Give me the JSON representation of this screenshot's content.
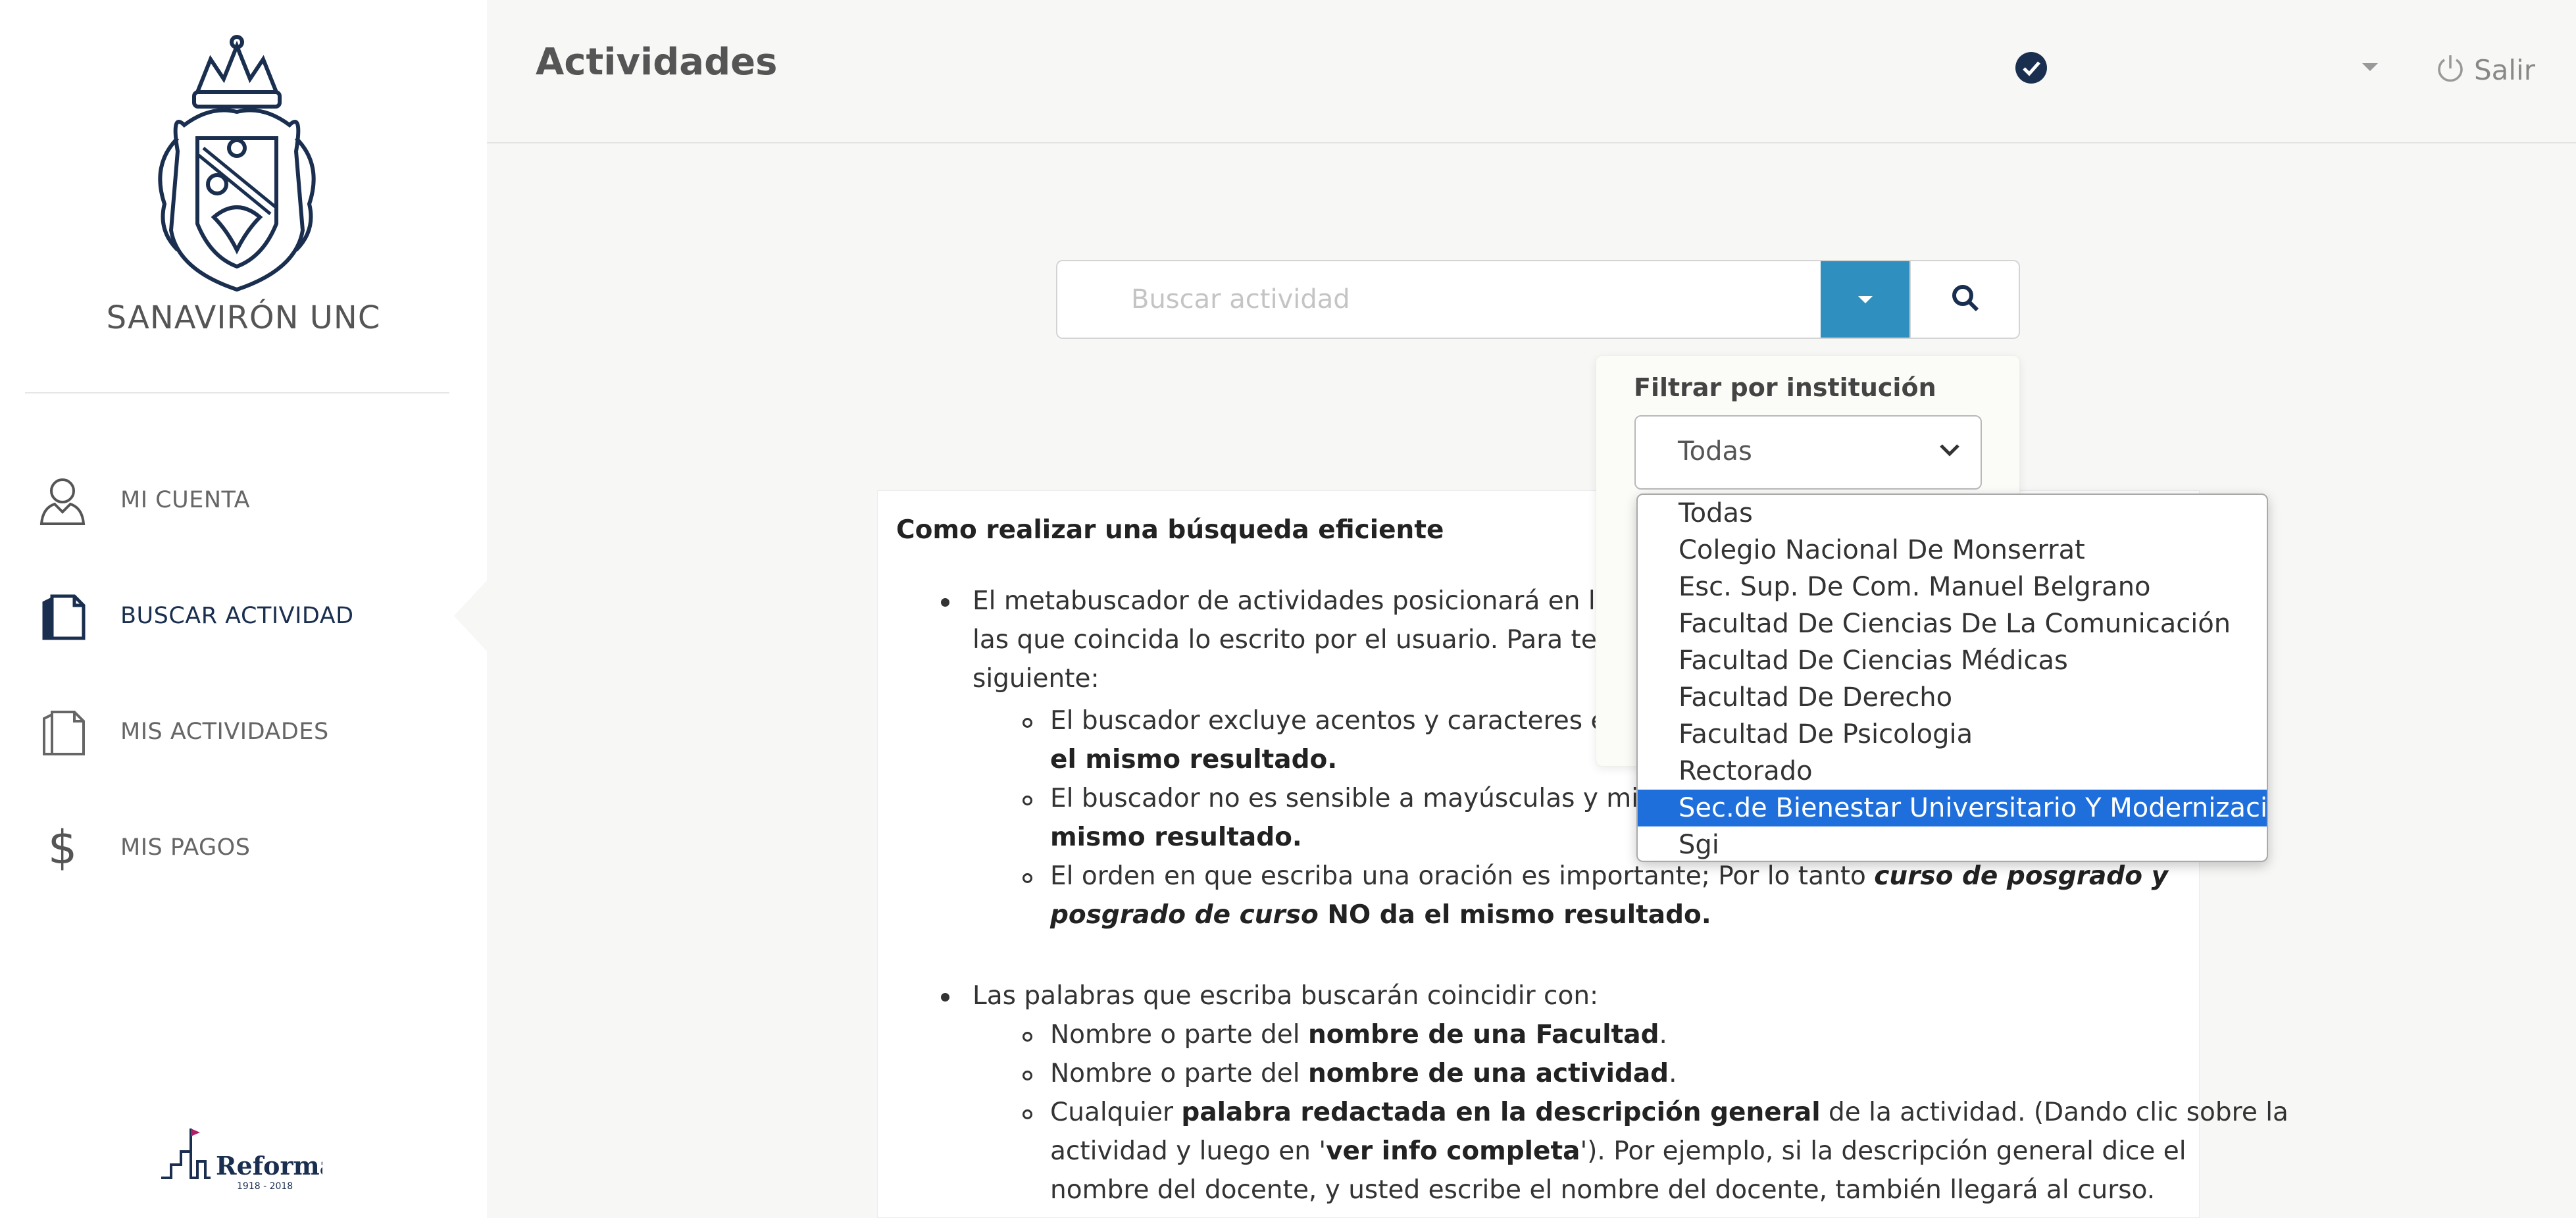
{
  "brand": {
    "name": "SANAVIRÓN UNC"
  },
  "sidebar": {
    "items": [
      {
        "label": "MI CUENTA",
        "icon": "user-icon",
        "active": false
      },
      {
        "label": "BUSCAR ACTIVIDAD",
        "icon": "documents-icon",
        "active": true
      },
      {
        "label": "MIS ACTIVIDADES",
        "icon": "documents-icon",
        "active": false
      },
      {
        "label": "MIS PAGOS",
        "icon": "dollar-icon",
        "active": false
      }
    ],
    "footer_logo": {
      "text": "Reforma",
      "years": "1918 - 2018"
    }
  },
  "header": {
    "title": "Actividades",
    "logout_label": "Salir"
  },
  "search": {
    "placeholder": "Buscar actividad",
    "value": ""
  },
  "filter": {
    "label": "Filtrar por institución",
    "selected": "Todas",
    "options": [
      "Todas",
      "Colegio Nacional De Monserrat",
      "Esc. Sup. De Com. Manuel Belgrano",
      "Facultad De Ciencias De La Comunicación",
      "Facultad De Ciencias Médicas",
      "Facultad De Derecho",
      "Facultad De Psicologia",
      "Rectorado",
      "Sec.de Bienestar Universitario Y Modernización",
      "Sgi"
    ],
    "highlighted_index": 8
  },
  "info": {
    "title": "Como realizar una búsqueda eficiente",
    "b1_l1": "El metabuscador de actividades posicionará en los",
    "b1_l2": "las que coincida lo escrito por el usuario. Para tene",
    "b1_l3": "siguiente:",
    "s1_l1": "El buscador excluye acentos y caracteres es",
    "s1_l2": "el mismo resultado.",
    "s2_l1": "El buscador no es sensible a mayúsculas y minu",
    "s2_l2": "mismo resultado.",
    "s3_l1a": "El orden en que escriba una oración es importante; Por lo tanto ",
    "s3_l1b": "curso de posgrado y",
    "s3_l2a": "posgrado de curso",
    "s3_l2b": " NO da el mismo resultado.",
    "b2_l1": "Las palabras que escriba buscarán coincidir con:",
    "t1a": "Nombre o parte del ",
    "t1b": "nombre de una Facultad",
    "t1c": ".",
    "t2a": "Nombre o parte del ",
    "t2b": "nombre de una actividad",
    "t2c": ".",
    "t3a": "Cualquier ",
    "t3b": "palabra redactada en la descripción general",
    "t3c": " de la actividad. (Dando clic sobre la",
    "t3d": "actividad y luego en '",
    "t3e": "ver info completa",
    "t3f": "'). Por ejemplo, si la descripción general dice el",
    "t3g": "nombre del docente, y usted escribe el nombre del docente, también llegará al curso."
  },
  "colors": {
    "accent": "#2f8fbe",
    "nav_dark": "#1a2f4f",
    "highlight": "#1e6fdc",
    "background": "#f7f7f5"
  }
}
